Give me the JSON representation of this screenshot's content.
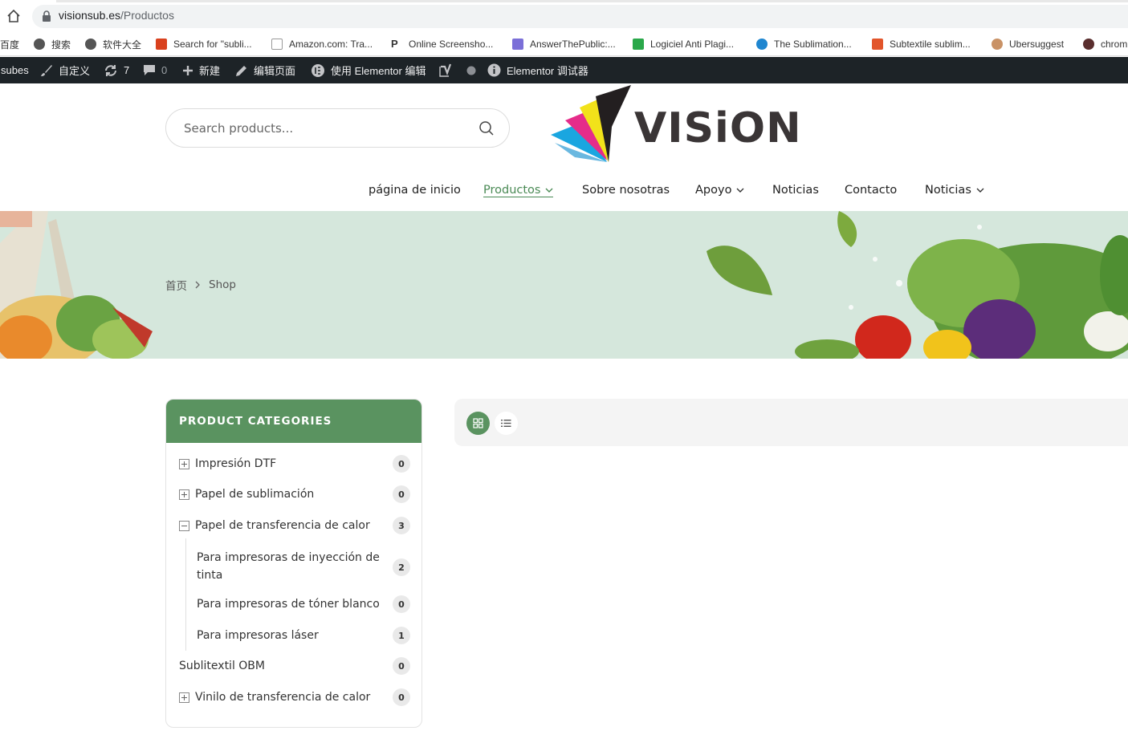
{
  "browser": {
    "url_domain": "visionsub.es",
    "url_path": "/Productos",
    "bookmarks": [
      {
        "label": "百度",
        "icon": "baidu-icon"
      },
      {
        "label": "搜索",
        "icon": "globe-icon"
      },
      {
        "label": "软件大全",
        "icon": "globe-icon"
      },
      {
        "label": "Search for \"subli...",
        "icon": "flame-icon"
      },
      {
        "label": "Amazon.com: Tra...",
        "icon": "amazon-icon"
      },
      {
        "label": "Online Screensho...",
        "icon": "p-icon"
      },
      {
        "label": "AnswerThePublic:...",
        "icon": "answerthepublic-icon"
      },
      {
        "label": "Logiciel Anti Plagi...",
        "icon": "pr-icon"
      },
      {
        "label": "The Sublimation...",
        "icon": "sublimation-icon"
      },
      {
        "label": "Subtextile sublim...",
        "icon": "subtextile-icon"
      },
      {
        "label": "Ubersuggest",
        "icon": "ubersuggest-icon"
      },
      {
        "label": "chrom",
        "icon": "k-icon"
      }
    ]
  },
  "wpbar": {
    "site": "subes",
    "customize": "自定义",
    "updates": "7",
    "comments": "0",
    "new": "新建",
    "edit_page": "编辑页面",
    "elementor_edit": "使用 Elementor 编辑",
    "elementor_debugger": "Elementor 调试器"
  },
  "header": {
    "search_placeholder": "Search products...",
    "logo_text": "VISiON"
  },
  "nav": {
    "items": [
      {
        "label": "página de inicio"
      },
      {
        "label": "Productos"
      },
      {
        "label": "Sobre nosotras"
      },
      {
        "label": "Apoyo"
      },
      {
        "label": "Noticias"
      },
      {
        "label": "Contacto"
      },
      {
        "label": "Noticias"
      }
    ]
  },
  "breadcrumb": {
    "home": "首页",
    "current": "Shop"
  },
  "categories": {
    "title": "PRODUCT CATEGORIES",
    "items": [
      {
        "label": "Impresión DTF",
        "count": "0"
      },
      {
        "label": "Papel de sublimación",
        "count": "0"
      },
      {
        "label": "Papel de transferencia de calor",
        "count": "3"
      },
      {
        "label_line1": "Para impresoras de inyección de",
        "label_line2": "tinta",
        "count": "2"
      },
      {
        "label": "Para impresoras de tóner blanco",
        "count": "0"
      },
      {
        "label": "Para impresoras láser",
        "count": "1"
      },
      {
        "label": "Sublitextil OBM",
        "count": "0"
      },
      {
        "label": "Vinilo de transferencia de calor",
        "count": "0"
      }
    ]
  },
  "colors": {
    "accent_green": "#5a9360",
    "banner_bg": "#d5e7dc",
    "wpbar_bg": "#1d2327"
  }
}
